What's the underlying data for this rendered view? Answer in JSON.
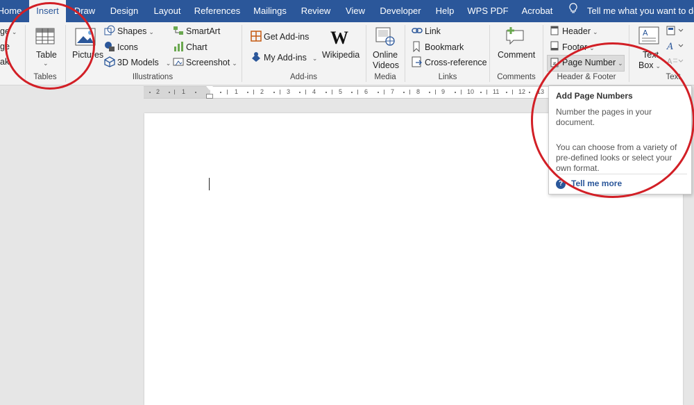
{
  "tabs": [
    {
      "label": "Home"
    },
    {
      "label": "Insert",
      "active": true
    },
    {
      "label": "Draw"
    },
    {
      "label": "Design"
    },
    {
      "label": "Layout"
    },
    {
      "label": "References"
    },
    {
      "label": "Mailings"
    },
    {
      "label": "Review"
    },
    {
      "label": "View"
    },
    {
      "label": "Developer"
    },
    {
      "label": "Help"
    },
    {
      "label": "WPS PDF"
    },
    {
      "label": "Acrobat"
    }
  ],
  "tell_me": "Tell me what you want to do",
  "ribbon": {
    "pages_partial": {
      "page": "ge",
      "blank": "ge",
      "break": "ak"
    },
    "tables": {
      "table": "Table",
      "group": "Tables"
    },
    "illustrations": {
      "pictures": "Pictures",
      "shapes": "Shapes",
      "icons": "Icons",
      "models": "3D Models",
      "smartart": "SmartArt",
      "chart": "Chart",
      "screenshot": "Screenshot",
      "group": "Illustrations"
    },
    "addins": {
      "get": "Get Add-ins",
      "my": "My Add-ins",
      "wikipedia": "Wikipedia",
      "group": "Add-ins"
    },
    "media": {
      "online": "Online",
      "videos": "Videos",
      "group": "Media"
    },
    "links": {
      "link": "Link",
      "bookmark": "Bookmark",
      "crossref": "Cross-reference",
      "group": "Links"
    },
    "comments": {
      "comment": "Comment",
      "group": "Comments"
    },
    "header_footer": {
      "header": "Header",
      "footer": "Footer",
      "page_number": "Page Number",
      "group": "Header & Footer"
    },
    "text": {
      "textbox_1": "Text",
      "textbox_2": "Box",
      "group": "Text"
    }
  },
  "ruler": {
    "numbers": [
      "2",
      "1",
      "1",
      "2",
      "3",
      "4",
      "5",
      "6",
      "7",
      "8",
      "9",
      "10",
      "11",
      "12",
      "13"
    ]
  },
  "tooltip": {
    "title": "Add Page Numbers",
    "line1": "Number the pages in your document.",
    "line2": "You can choose from a variety of pre-defined looks or select your own format.",
    "link": "Tell me more"
  },
  "annotation_color": "#d21f26",
  "accent": "#2b579a"
}
